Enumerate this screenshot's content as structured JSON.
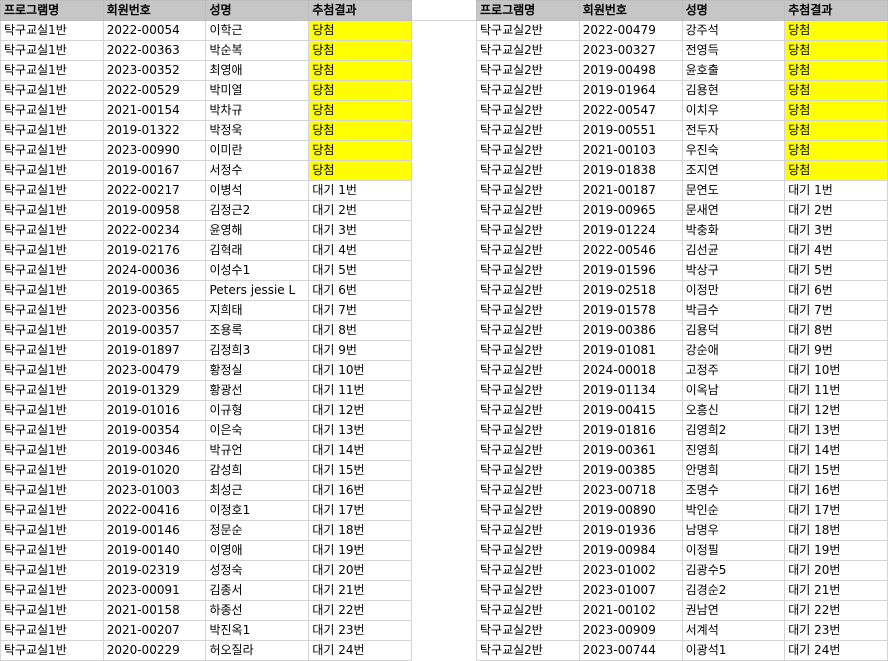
{
  "headers": [
    "프로그램명",
    "회원번호",
    "성명",
    "추첨결과"
  ],
  "colors": {
    "header_bg": "#c6c6c6",
    "winner_bg": "#ffff00",
    "grid": "#d4d4d4"
  },
  "left_table": {
    "rows": [
      [
        "탁구교실1반",
        "2022-00054",
        "이학근",
        "당첨"
      ],
      [
        "탁구교실1반",
        "2022-00363",
        "박순복",
        "당첨"
      ],
      [
        "탁구교실1반",
        "2023-00352",
        "최영애",
        "당첨"
      ],
      [
        "탁구교실1반",
        "2022-00529",
        "박미열",
        "당첨"
      ],
      [
        "탁구교실1반",
        "2021-00154",
        "박차규",
        "당첨"
      ],
      [
        "탁구교실1반",
        "2019-01322",
        "박정욱",
        "당첨"
      ],
      [
        "탁구교실1반",
        "2023-00990",
        "이미란",
        "당첨"
      ],
      [
        "탁구교실1반",
        "2019-00167",
        "서정수",
        "당첨"
      ],
      [
        "탁구교실1반",
        "2022-00217",
        "이병석",
        "대기 1번"
      ],
      [
        "탁구교실1반",
        "2019-00958",
        "김정근2",
        "대기 2번"
      ],
      [
        "탁구교실1반",
        "2022-00234",
        "윤영해",
        "대기 3번"
      ],
      [
        "탁구교실1반",
        "2019-02176",
        "김혁래",
        "대기 4번"
      ],
      [
        "탁구교실1반",
        "2024-00036",
        "이성수1",
        "대기 5번"
      ],
      [
        "탁구교실1반",
        "2019-00365",
        "Peters jessie L",
        "대기 6번"
      ],
      [
        "탁구교실1반",
        "2023-00356",
        "지희태",
        "대기 7번"
      ],
      [
        "탁구교실1반",
        "2019-00357",
        "조용록",
        "대기 8번"
      ],
      [
        "탁구교실1반",
        "2019-01897",
        "김정희3",
        "대기 9번"
      ],
      [
        "탁구교실1반",
        "2023-00479",
        "황정실",
        "대기 10번"
      ],
      [
        "탁구교실1반",
        "2019-01329",
        "황광선",
        "대기 11번"
      ],
      [
        "탁구교실1반",
        "2019-01016",
        "이규형",
        "대기 12번"
      ],
      [
        "탁구교실1반",
        "2019-00354",
        "이은숙",
        "대기 13번"
      ],
      [
        "탁구교실1반",
        "2019-00346",
        "박규언",
        "대기 14번"
      ],
      [
        "탁구교실1반",
        "2019-01020",
        "감성희",
        "대기 15번"
      ],
      [
        "탁구교실1반",
        "2023-01003",
        "최성근",
        "대기 16번"
      ],
      [
        "탁구교실1반",
        "2022-00416",
        "이정호1",
        "대기 17번"
      ],
      [
        "탁구교실1반",
        "2019-00146",
        "정문순",
        "대기 18번"
      ],
      [
        "탁구교실1반",
        "2019-00140",
        "이영애",
        "대기 19번"
      ],
      [
        "탁구교실1반",
        "2019-02319",
        "성정숙",
        "대기 20번"
      ],
      [
        "탁구교실1반",
        "2023-00091",
        "김종서",
        "대기 21번"
      ],
      [
        "탁구교실1반",
        "2021-00158",
        "하종선",
        "대기 22번"
      ],
      [
        "탁구교실1반",
        "2021-00207",
        "박진옥1",
        "대기 23번"
      ],
      [
        "탁구교실1반",
        "2020-00229",
        "허오질라",
        "대기 24번"
      ]
    ]
  },
  "right_table": {
    "rows": [
      [
        "탁구교실2반",
        "2022-00479",
        "강주석",
        "당첨"
      ],
      [
        "탁구교실2반",
        "2023-00327",
        "전영득",
        "당첨"
      ],
      [
        "탁구교실2반",
        "2019-00498",
        "윤호출",
        "당첨"
      ],
      [
        "탁구교실2반",
        "2019-01964",
        "김용현",
        "당첨"
      ],
      [
        "탁구교실2반",
        "2022-00547",
        "이치우",
        "당첨"
      ],
      [
        "탁구교실2반",
        "2019-00551",
        "전두자",
        "당첨"
      ],
      [
        "탁구교실2반",
        "2021-00103",
        "우진숙",
        "당첨"
      ],
      [
        "탁구교실2반",
        "2019-01838",
        "조지연",
        "당첨"
      ],
      [
        "탁구교실2반",
        "2021-00187",
        "문연도",
        "대기 1번"
      ],
      [
        "탁구교실2반",
        "2019-00965",
        "문새연",
        "대기 2번"
      ],
      [
        "탁구교실2반",
        "2019-01224",
        "박충화",
        "대기 3번"
      ],
      [
        "탁구교실2반",
        "2022-00546",
        "김선균",
        "대기 4번"
      ],
      [
        "탁구교실2반",
        "2019-01596",
        "박상구",
        "대기 5번"
      ],
      [
        "탁구교실2반",
        "2019-02518",
        "이정만",
        "대기 6번"
      ],
      [
        "탁구교실2반",
        "2019-01578",
        "박금수",
        "대기 7번"
      ],
      [
        "탁구교실2반",
        "2019-00386",
        "김용덕",
        "대기 8번"
      ],
      [
        "탁구교실2반",
        "2019-01081",
        "강순애",
        "대기 9번"
      ],
      [
        "탁구교실2반",
        "2024-00018",
        "고정주",
        "대기 10번"
      ],
      [
        "탁구교실2반",
        "2019-01134",
        "이옥남",
        "대기 11번"
      ],
      [
        "탁구교실2반",
        "2019-00415",
        "오흥신",
        "대기 12번"
      ],
      [
        "탁구교실2반",
        "2019-01816",
        "김영희2",
        "대기 13번"
      ],
      [
        "탁구교실2반",
        "2019-00361",
        "진영희",
        "대기 14번"
      ],
      [
        "탁구교실2반",
        "2019-00385",
        "안명희",
        "대기 15번"
      ],
      [
        "탁구교실2반",
        "2023-00718",
        "조명수",
        "대기 16번"
      ],
      [
        "탁구교실2반",
        "2019-00890",
        "박인순",
        "대기 17번"
      ],
      [
        "탁구교실2반",
        "2019-01936",
        "남명우",
        "대기 18번"
      ],
      [
        "탁구교실2반",
        "2019-00984",
        "이정필",
        "대기 19번"
      ],
      [
        "탁구교실2반",
        "2023-01002",
        "김광수5",
        "대기 20번"
      ],
      [
        "탁구교실2반",
        "2023-01007",
        "김경순2",
        "대기 21번"
      ],
      [
        "탁구교실2반",
        "2021-00102",
        "권남연",
        "대기 22번"
      ],
      [
        "탁구교실2반",
        "2023-00909",
        "서계석",
        "대기 23번"
      ],
      [
        "탁구교실2반",
        "2023-00744",
        "이광석1",
        "대기 24번"
      ]
    ]
  }
}
